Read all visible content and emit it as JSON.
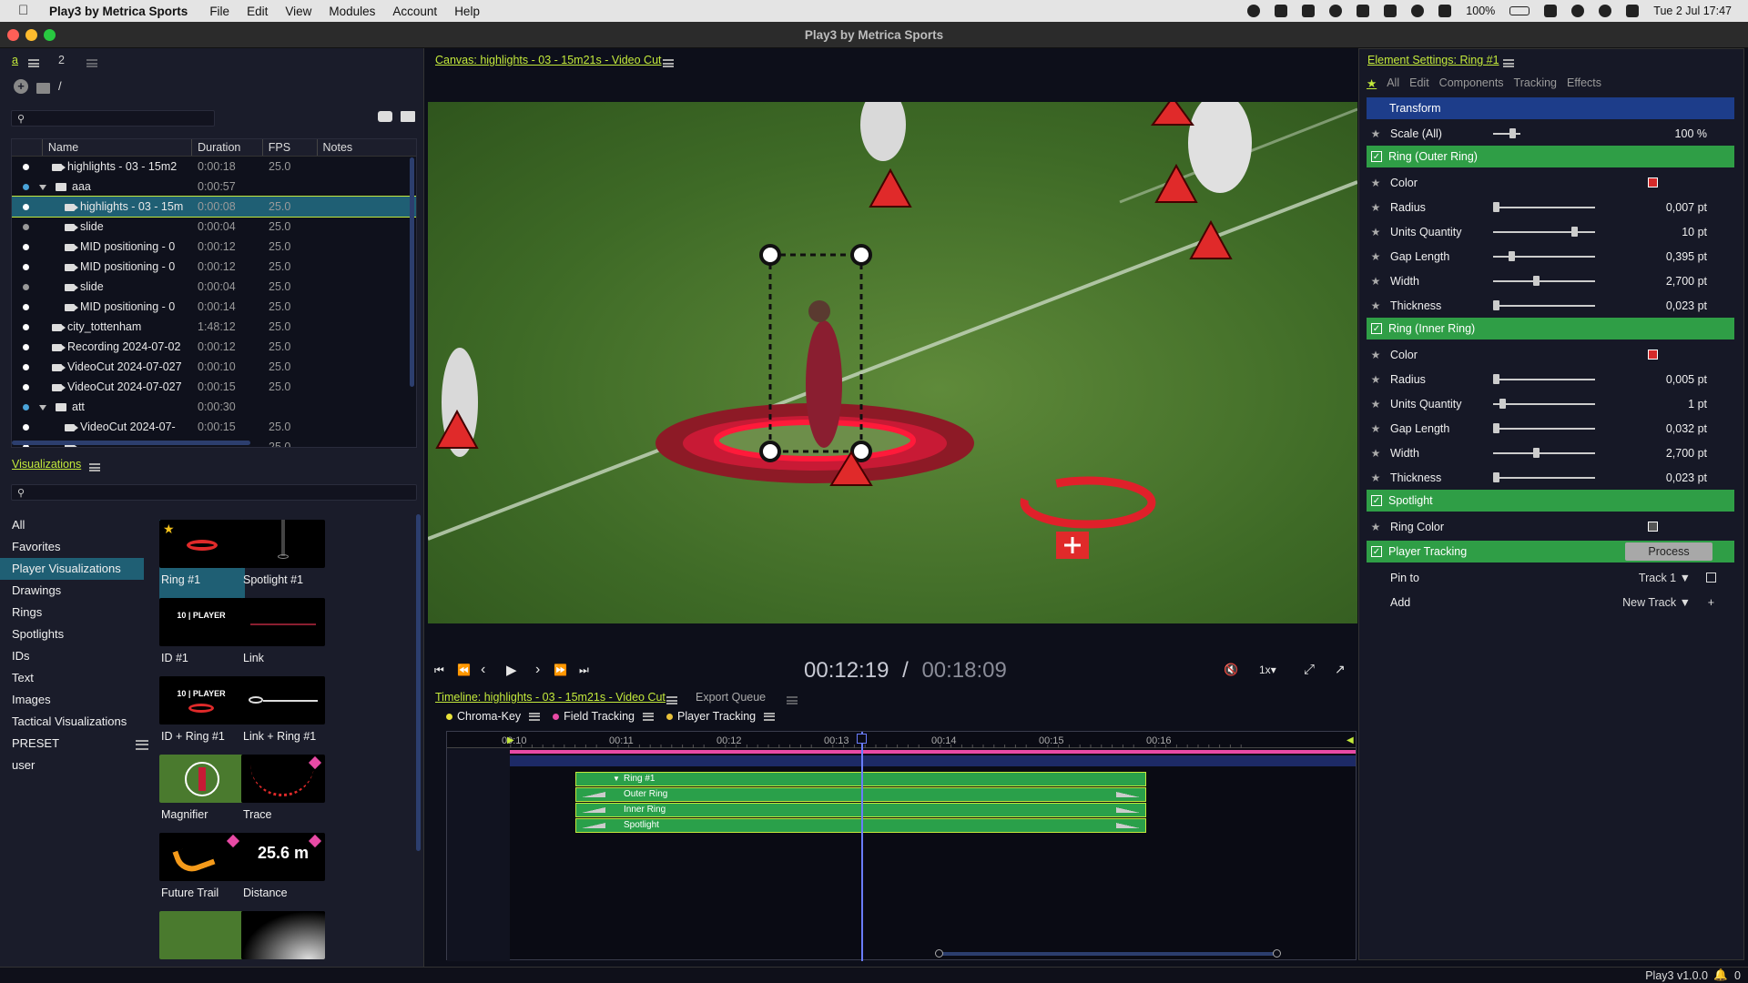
{
  "menubar": {
    "app": "Play3 by Metrica Sports",
    "items": [
      "File",
      "Edit",
      "View",
      "Modules",
      "Account",
      "Help"
    ],
    "battery": "100%",
    "datetime": "Tue 2 Jul  17:47"
  },
  "window": {
    "title": "Play3 by Metrica Sports"
  },
  "left": {
    "tab_a": "a",
    "tab_2": "2",
    "path": "/",
    "columns": [
      "Name",
      "Duration",
      "FPS",
      "Notes"
    ],
    "files": [
      {
        "name": "highlights - 03 - 15m2",
        "duration": "0:00:18",
        "fps": "25.0",
        "type": "video",
        "indent": 0,
        "dot": "white"
      },
      {
        "name": "aaa",
        "duration": "0:00:57",
        "fps": "",
        "type": "folder",
        "indent": 0,
        "dot": "blue",
        "expanded": true
      },
      {
        "name": "highlights - 03 - 15m",
        "duration": "0:00:08",
        "fps": "25.0",
        "type": "video",
        "indent": 1,
        "dot": "white",
        "selected": true
      },
      {
        "name": "slide",
        "duration": "0:00:04",
        "fps": "25.0",
        "type": "video",
        "indent": 1,
        "dot": "grey"
      },
      {
        "name": "MID positioning - 0",
        "duration": "0:00:12",
        "fps": "25.0",
        "type": "video",
        "indent": 1,
        "dot": "white"
      },
      {
        "name": "MID positioning - 0",
        "duration": "0:00:12",
        "fps": "25.0",
        "type": "video",
        "indent": 1,
        "dot": "white"
      },
      {
        "name": "slide",
        "duration": "0:00:04",
        "fps": "25.0",
        "type": "video",
        "indent": 1,
        "dot": "grey"
      },
      {
        "name": "MID positioning - 0",
        "duration": "0:00:14",
        "fps": "25.0",
        "type": "video",
        "indent": 1,
        "dot": "white"
      },
      {
        "name": "city_tottenham",
        "duration": "1:48:12",
        "fps": "25.0",
        "type": "video",
        "indent": 0,
        "dot": "white"
      },
      {
        "name": "Recording 2024-07-02",
        "duration": "0:00:12",
        "fps": "25.0",
        "type": "video",
        "indent": 0,
        "dot": "white"
      },
      {
        "name": "VideoCut 2024-07-027",
        "duration": "0:00:10",
        "fps": "25.0",
        "type": "video",
        "indent": 0,
        "dot": "white"
      },
      {
        "name": "VideoCut 2024-07-027",
        "duration": "0:00:15",
        "fps": "25.0",
        "type": "video",
        "indent": 0,
        "dot": "white"
      },
      {
        "name": "att",
        "duration": "0:00:30",
        "fps": "",
        "type": "folder",
        "indent": 0,
        "dot": "blue",
        "expanded": true
      },
      {
        "name": "VideoCut 2024-07-",
        "duration": "0:00:15",
        "fps": "25.0",
        "type": "video",
        "indent": 1,
        "dot": "white"
      },
      {
        "name": "",
        "duration": "",
        "fps": "25.0",
        "type": "video",
        "indent": 1,
        "dot": "white"
      }
    ],
    "vis_title": "Visualizations",
    "categories": [
      "All",
      "Favorites",
      "Player Visualizations",
      "Drawings",
      "Rings",
      "Spotlights",
      "IDs",
      "Text",
      "Images",
      "Tactical Visualizations",
      "PRESET",
      "user"
    ],
    "tiles": [
      {
        "label": "Ring #1",
        "thumb_text": ""
      },
      {
        "label": "Spotlight #1",
        "thumb_text": ""
      },
      {
        "label": "ID #1",
        "thumb_text": "10 | PLAYER"
      },
      {
        "label": "Link",
        "thumb_text": ""
      },
      {
        "label": "ID + Ring #1",
        "thumb_text": "10 | PLAYER"
      },
      {
        "label": "Link + Ring #1",
        "thumb_text": ""
      },
      {
        "label": "Magnifier",
        "thumb_text": ""
      },
      {
        "label": "Trace",
        "thumb_text": ""
      },
      {
        "label": "Future Trail",
        "thumb_text": ""
      },
      {
        "label": "Distance",
        "thumb_text": "25.6 m"
      },
      {
        "label": "",
        "thumb_text": ""
      },
      {
        "label": "",
        "thumb_text": ""
      }
    ]
  },
  "canvas": {
    "title": "Canvas: highlights - 03 - 15m21s - Video Cut"
  },
  "transport": {
    "current": "00:12:19",
    "separator": "/",
    "total": "00:18:09",
    "speed": "1x"
  },
  "timeline": {
    "title": "Timeline: highlights - 03 - 15m21s - Video Cut",
    "export": "Export Queue",
    "layers": [
      {
        "name": "Chroma-Key",
        "color": "#e8e23a"
      },
      {
        "name": "Field Tracking",
        "color": "#e84aa5"
      },
      {
        "name": "Player Tracking",
        "color": "#e8c13a"
      }
    ],
    "ticks": [
      "00:10",
      "00:11",
      "00:12",
      "00:13",
      "00:14",
      "00:15",
      "00:16"
    ],
    "clips": [
      "Ring #1",
      "Outer Ring",
      "Inner Ring",
      "Spotlight"
    ]
  },
  "settings": {
    "title": "Element Settings: Ring #1",
    "tabs": [
      "All",
      "Edit",
      "Components",
      "Tracking",
      "Effects"
    ],
    "transform": "Transform",
    "scale": {
      "label": "Scale (All)",
      "value": "100 %",
      "level": 0.17
    },
    "outer": {
      "title": "Ring (Outer Ring)",
      "rows": [
        {
          "label": "Color",
          "value": "",
          "swatch": "#d42a2a"
        },
        {
          "label": "Radius",
          "value": "0,007 pt",
          "level": 0.0
        },
        {
          "label": "Units Quantity",
          "value": "10 pt",
          "level": 0.82
        },
        {
          "label": "Gap Length",
          "value": "0,395 pt",
          "level": 0.16
        },
        {
          "label": "Width",
          "value": "2,700 pt",
          "level": 0.42
        },
        {
          "label": "Thickness",
          "value": "0,023 pt",
          "level": 0.0
        }
      ]
    },
    "inner": {
      "title": "Ring (Inner Ring)",
      "rows": [
        {
          "label": "Color",
          "value": "",
          "swatch": "#d42a2a"
        },
        {
          "label": "Radius",
          "value": "0,005 pt",
          "level": 0.0
        },
        {
          "label": "Units Quantity",
          "value": "1 pt",
          "level": 0.07
        },
        {
          "label": "Gap Length",
          "value": "0,032 pt",
          "level": 0.0
        },
        {
          "label": "Width",
          "value": "2,700 pt",
          "level": 0.42
        },
        {
          "label": "Thickness",
          "value": "0,023 pt",
          "level": 0.0
        }
      ]
    },
    "spotlight": {
      "title": "Spotlight",
      "ring_color": "Ring Color"
    },
    "tracking": {
      "title": "Player Tracking",
      "process": "Process",
      "pin_label": "Pin to",
      "pin_value": "Track 1",
      "add_label": "Add",
      "add_value": "New Track",
      "plus": "+"
    }
  },
  "status": {
    "version": "Play3 v1.0.0",
    "notifications": "0"
  },
  "colors": {
    "accent": "#c3e93b",
    "section": "#2f9e46",
    "selection": "#1f5f74",
    "ring": "#d42a2a"
  }
}
